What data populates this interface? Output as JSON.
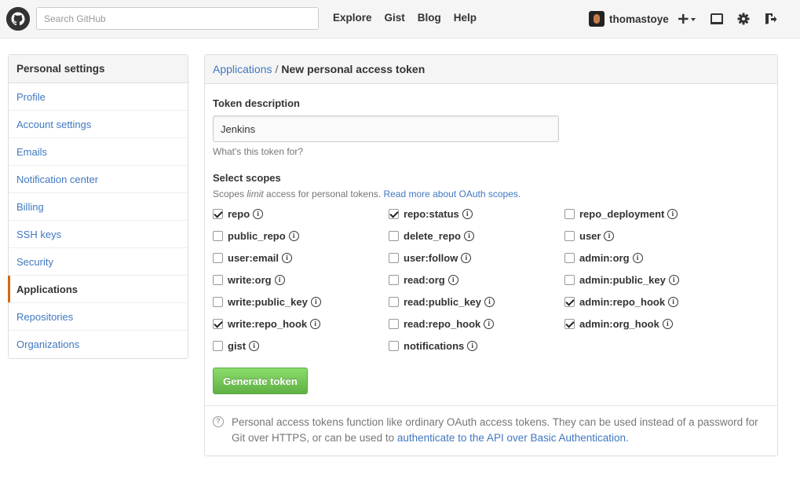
{
  "header": {
    "search_placeholder": "Search GitHub",
    "nav": [
      "Explore",
      "Gist",
      "Blog",
      "Help"
    ],
    "username": "thomastoye"
  },
  "sidebar": {
    "title": "Personal settings",
    "items": [
      {
        "label": "Profile"
      },
      {
        "label": "Account settings"
      },
      {
        "label": "Emails"
      },
      {
        "label": "Notification center"
      },
      {
        "label": "Billing"
      },
      {
        "label": "SSH keys"
      },
      {
        "label": "Security"
      },
      {
        "label": "Applications",
        "selected": true
      },
      {
        "label": "Repositories"
      },
      {
        "label": "Organizations"
      }
    ]
  },
  "main": {
    "breadcrumb_parent": "Applications",
    "breadcrumb_sep": "/",
    "breadcrumb_current": "New personal access token",
    "token_label": "Token description",
    "token_value": "Jenkins",
    "token_note": "What's this token for?",
    "scopes_label": "Select scopes",
    "scopes_note_prefix": "Scopes ",
    "scopes_note_em": "limit",
    "scopes_note_middle": " access for personal tokens. ",
    "scopes_note_link": "Read more about OAuth scopes.",
    "scopes": [
      {
        "name": "repo",
        "checked": true
      },
      {
        "name": "repo:status",
        "checked": true
      },
      {
        "name": "repo_deployment",
        "checked": false
      },
      {
        "name": "public_repo",
        "checked": false
      },
      {
        "name": "delete_repo",
        "checked": false
      },
      {
        "name": "user",
        "checked": false
      },
      {
        "name": "user:email",
        "checked": false
      },
      {
        "name": "user:follow",
        "checked": false
      },
      {
        "name": "admin:org",
        "checked": false
      },
      {
        "name": "write:org",
        "checked": false
      },
      {
        "name": "read:org",
        "checked": false
      },
      {
        "name": "admin:public_key",
        "checked": false
      },
      {
        "name": "write:public_key",
        "checked": false
      },
      {
        "name": "read:public_key",
        "checked": false
      },
      {
        "name": "admin:repo_hook",
        "checked": true
      },
      {
        "name": "write:repo_hook",
        "checked": true
      },
      {
        "name": "read:repo_hook",
        "checked": false
      },
      {
        "name": "admin:org_hook",
        "checked": true
      },
      {
        "name": "gist",
        "checked": false
      },
      {
        "name": "notifications",
        "checked": false
      }
    ],
    "generate_button": "Generate token",
    "help_text": "Personal access tokens function like ordinary OAuth access tokens. They can be used instead of a password for Git over HTTPS, or can be used to ",
    "help_link": "authenticate to the API over Basic Authentication",
    "help_suffix": "."
  }
}
